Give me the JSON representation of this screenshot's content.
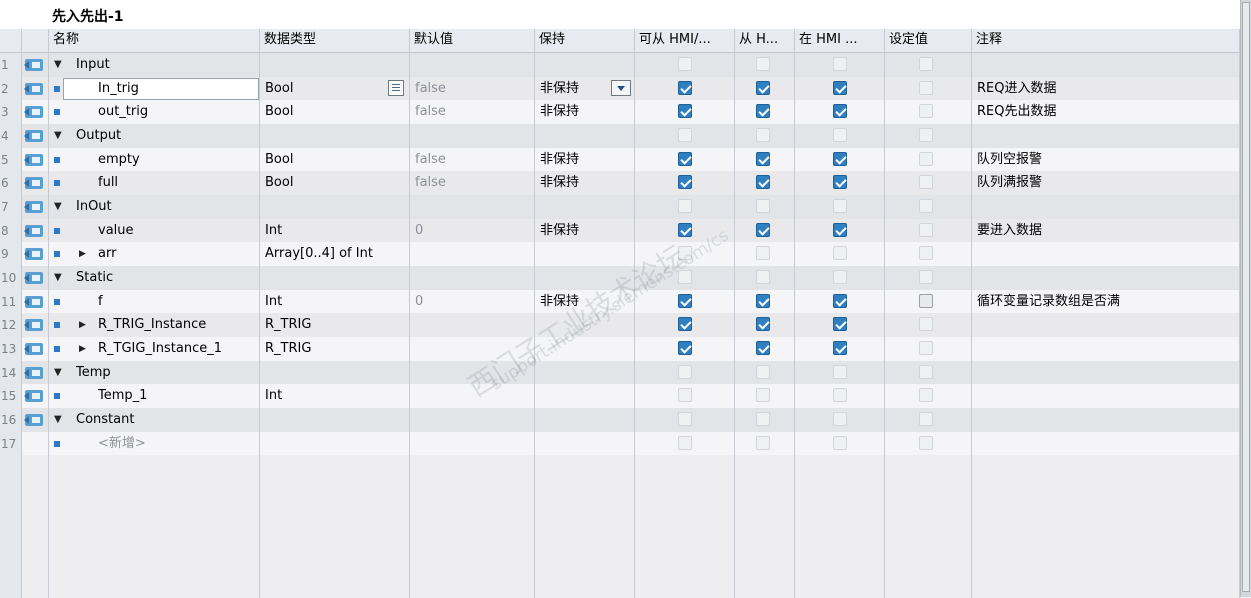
{
  "title": "先入先出-1",
  "headers": {
    "name": "名称",
    "datatype": "数据类型",
    "default": "默认值",
    "retain": "保持",
    "hmi_access": "可从 HMI/...",
    "hmi_visible": "从 H...",
    "hmi_setpoint": "在 HMI ...",
    "setpoint": "设定值",
    "comment": "注释"
  },
  "rows": [
    {
      "num": "1",
      "name": "Input",
      "section": true
    },
    {
      "num": "2",
      "name": "In_trig",
      "datatype": "Bool",
      "default": "false",
      "retain": "非保持",
      "hmi": [
        true,
        true,
        true
      ],
      "comment": "REQ进入数据"
    },
    {
      "num": "3",
      "name": "out_trig",
      "datatype": "Bool",
      "default": "false",
      "retain": "非保持",
      "hmi": [
        true,
        true,
        true
      ],
      "comment": "REQ先出数据"
    },
    {
      "num": "4",
      "name": "Output",
      "section": true
    },
    {
      "num": "5",
      "name": "empty",
      "datatype": "Bool",
      "default": "false",
      "retain": "非保持",
      "hmi": [
        true,
        true,
        true
      ],
      "comment": "队列空报警"
    },
    {
      "num": "6",
      "name": "full",
      "datatype": "Bool",
      "default": "false",
      "retain": "非保持",
      "hmi": [
        true,
        true,
        true
      ],
      "comment": "队列满报警"
    },
    {
      "num": "7",
      "name": "InOut",
      "section": true
    },
    {
      "num": "8",
      "name": "value",
      "datatype": "Int",
      "default": "0",
      "retain": "非保持",
      "hmi": [
        true,
        true,
        true
      ],
      "comment": "要进入数据"
    },
    {
      "num": "9",
      "name": "arr",
      "datatype": "Array[0..4] of Int",
      "expandable": true,
      "hmi": [
        false,
        false,
        false
      ]
    },
    {
      "num": "10",
      "name": "Static",
      "section": true
    },
    {
      "num": "11",
      "name": "f",
      "datatype": "Int",
      "default": "0",
      "retain": "非保持",
      "hmi": [
        true,
        true,
        true
      ],
      "setpoint_box": true,
      "comment": "循环变量记录数组是否满"
    },
    {
      "num": "12",
      "name": "R_TRIG_Instance",
      "datatype": "R_TRIG",
      "expandable": true,
      "hmi": [
        true,
        true,
        true
      ]
    },
    {
      "num": "13",
      "name": "R_TGIG_Instance_1",
      "datatype": "R_TRIG",
      "expandable": true,
      "hmi": [
        true,
        true,
        true
      ]
    },
    {
      "num": "14",
      "name": "Temp",
      "section": true
    },
    {
      "num": "15",
      "name": "Temp_1",
      "datatype": "Int"
    },
    {
      "num": "16",
      "name": "Constant",
      "section": true
    },
    {
      "num": "17",
      "name": "<新增>",
      "placeholder": true
    }
  ],
  "watermark": {
    "cn": "西门子工业技术论坛",
    "url": "support.industry.siemens.com/cs"
  },
  "colors": {
    "accent": "#2f7fc1",
    "header_bg": "#e7eaee",
    "grid_line": "#c7cbd1"
  }
}
